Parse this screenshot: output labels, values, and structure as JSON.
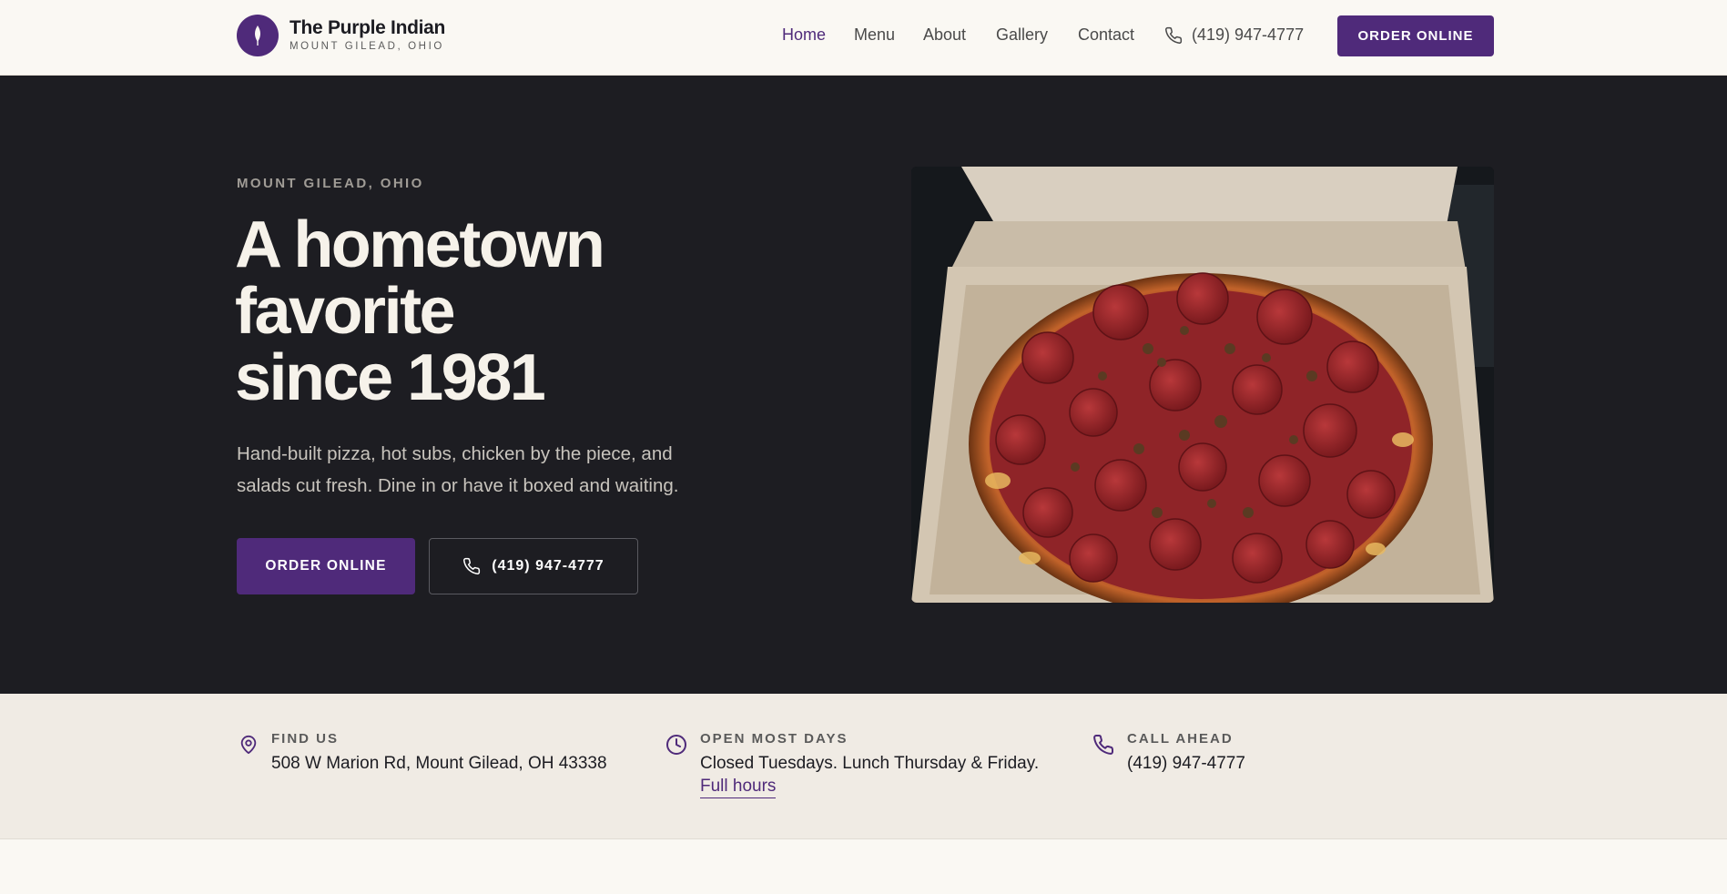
{
  "header": {
    "brand_name": "The Purple Indian",
    "brand_location": "MOUNT GILEAD, OHIO",
    "logo_icon": "feather-icon",
    "nav": [
      {
        "label": "Home",
        "active": true
      },
      {
        "label": "Menu"
      },
      {
        "label": "About"
      },
      {
        "label": "Gallery"
      },
      {
        "label": "Contact"
      }
    ],
    "phone": "(419) 947-4777",
    "order_label": "ORDER ONLINE"
  },
  "hero": {
    "eyebrow": "MOUNT GILEAD, OHIO",
    "title_lines": [
      "A hometown",
      "favorite",
      "since 1981"
    ],
    "description": "Hand-built pizza, hot subs, chicken by the piece, and salads cut fresh. Dine in or have it boxed and waiting.",
    "order_label": "ORDER ONLINE",
    "phone_label": "(419) 947-4777",
    "image_subject": "pepperoni-and-sausage-pizza-in-box"
  },
  "info": {
    "find": {
      "label": "FIND US",
      "value": "508 W Marion Rd, Mount Gilead, OH 43338",
      "icon": "map-pin-icon"
    },
    "hours": {
      "label": "OPEN MOST DAYS",
      "value": "Closed Tuesdays. Lunch Thursday & Friday.",
      "link": "Full hours",
      "icon": "clock-icon"
    },
    "call": {
      "label": "CALL AHEAD",
      "value": "(419) 947-4777",
      "icon": "phone-icon"
    }
  },
  "colors": {
    "brand_purple": "#4f2a7a",
    "hero_bg": "#1d1d22",
    "page_bg": "#faf8f3",
    "info_bg": "#f0ebe4"
  }
}
